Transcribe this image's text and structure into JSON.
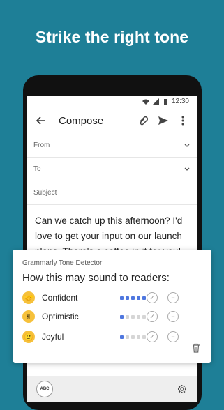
{
  "headline": "Strike the right tone",
  "status": {
    "time": "12:30"
  },
  "compose": {
    "title": "Compose",
    "from_label": "From",
    "to_label": "To",
    "subject_placeholder": "Subject",
    "body": "Can we catch up this afternoon? I'd love to get your input on our launch plans. There's a coffee in it for you!"
  },
  "tone_card": {
    "caption": "Grammarly Tone Detector",
    "heading": "How this may sound to readers:",
    "tones": [
      {
        "label": "Confident",
        "icon": "handshake-icon",
        "emoji": "🤝",
        "level": 5,
        "max": 5
      },
      {
        "label": "Optimistic",
        "icon": "victory-hand-icon",
        "emoji": "✌",
        "level": 1,
        "max": 5
      },
      {
        "label": "Joyful",
        "icon": "smile-icon",
        "emoji": "🙂",
        "level": 1,
        "max": 5
      }
    ]
  },
  "keyboard_bar": {
    "abc_label": "ABC"
  },
  "colors": {
    "background": "#1e7f97",
    "accent": "#4f77df",
    "emoji_yellow": "#f6c13b"
  }
}
